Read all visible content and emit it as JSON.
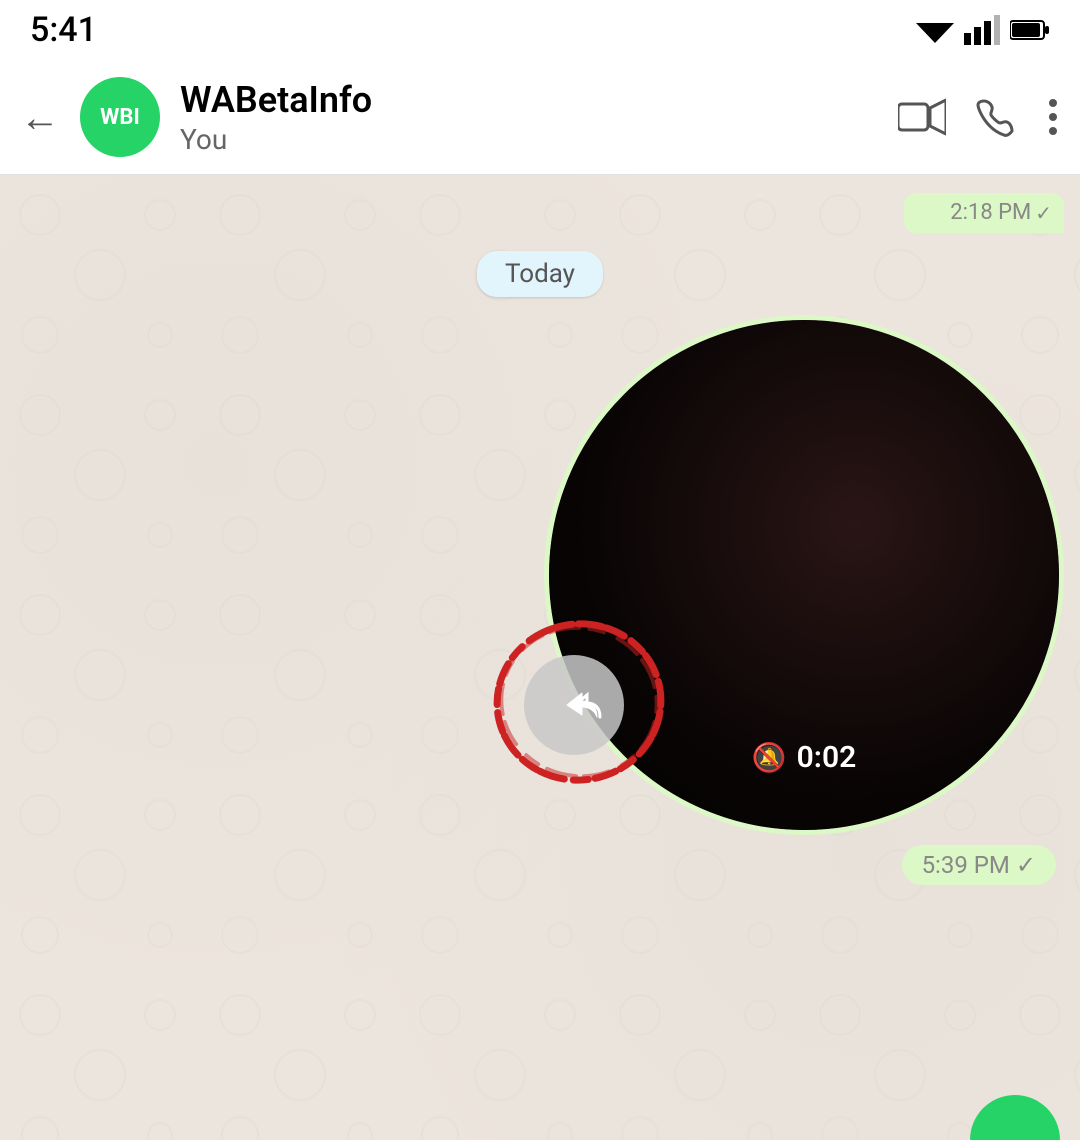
{
  "statusBar": {
    "time": "5:41",
    "icons": [
      "wifi",
      "signal",
      "battery"
    ]
  },
  "appBar": {
    "backLabel": "←",
    "avatarText": "WBI",
    "contactName": "WABetaInfo",
    "contactStatus": "You",
    "actions": {
      "video": "video-camera",
      "phone": "phone",
      "more": "more-options"
    }
  },
  "chat": {
    "previousMessage": {
      "time": "2:18 PM",
      "check": "✓"
    },
    "dateSeparator": "Today",
    "videoMessage": {
      "muteIcon": "🔕",
      "duration": "0:02",
      "time": "5:39 PM",
      "check": "✓"
    }
  }
}
